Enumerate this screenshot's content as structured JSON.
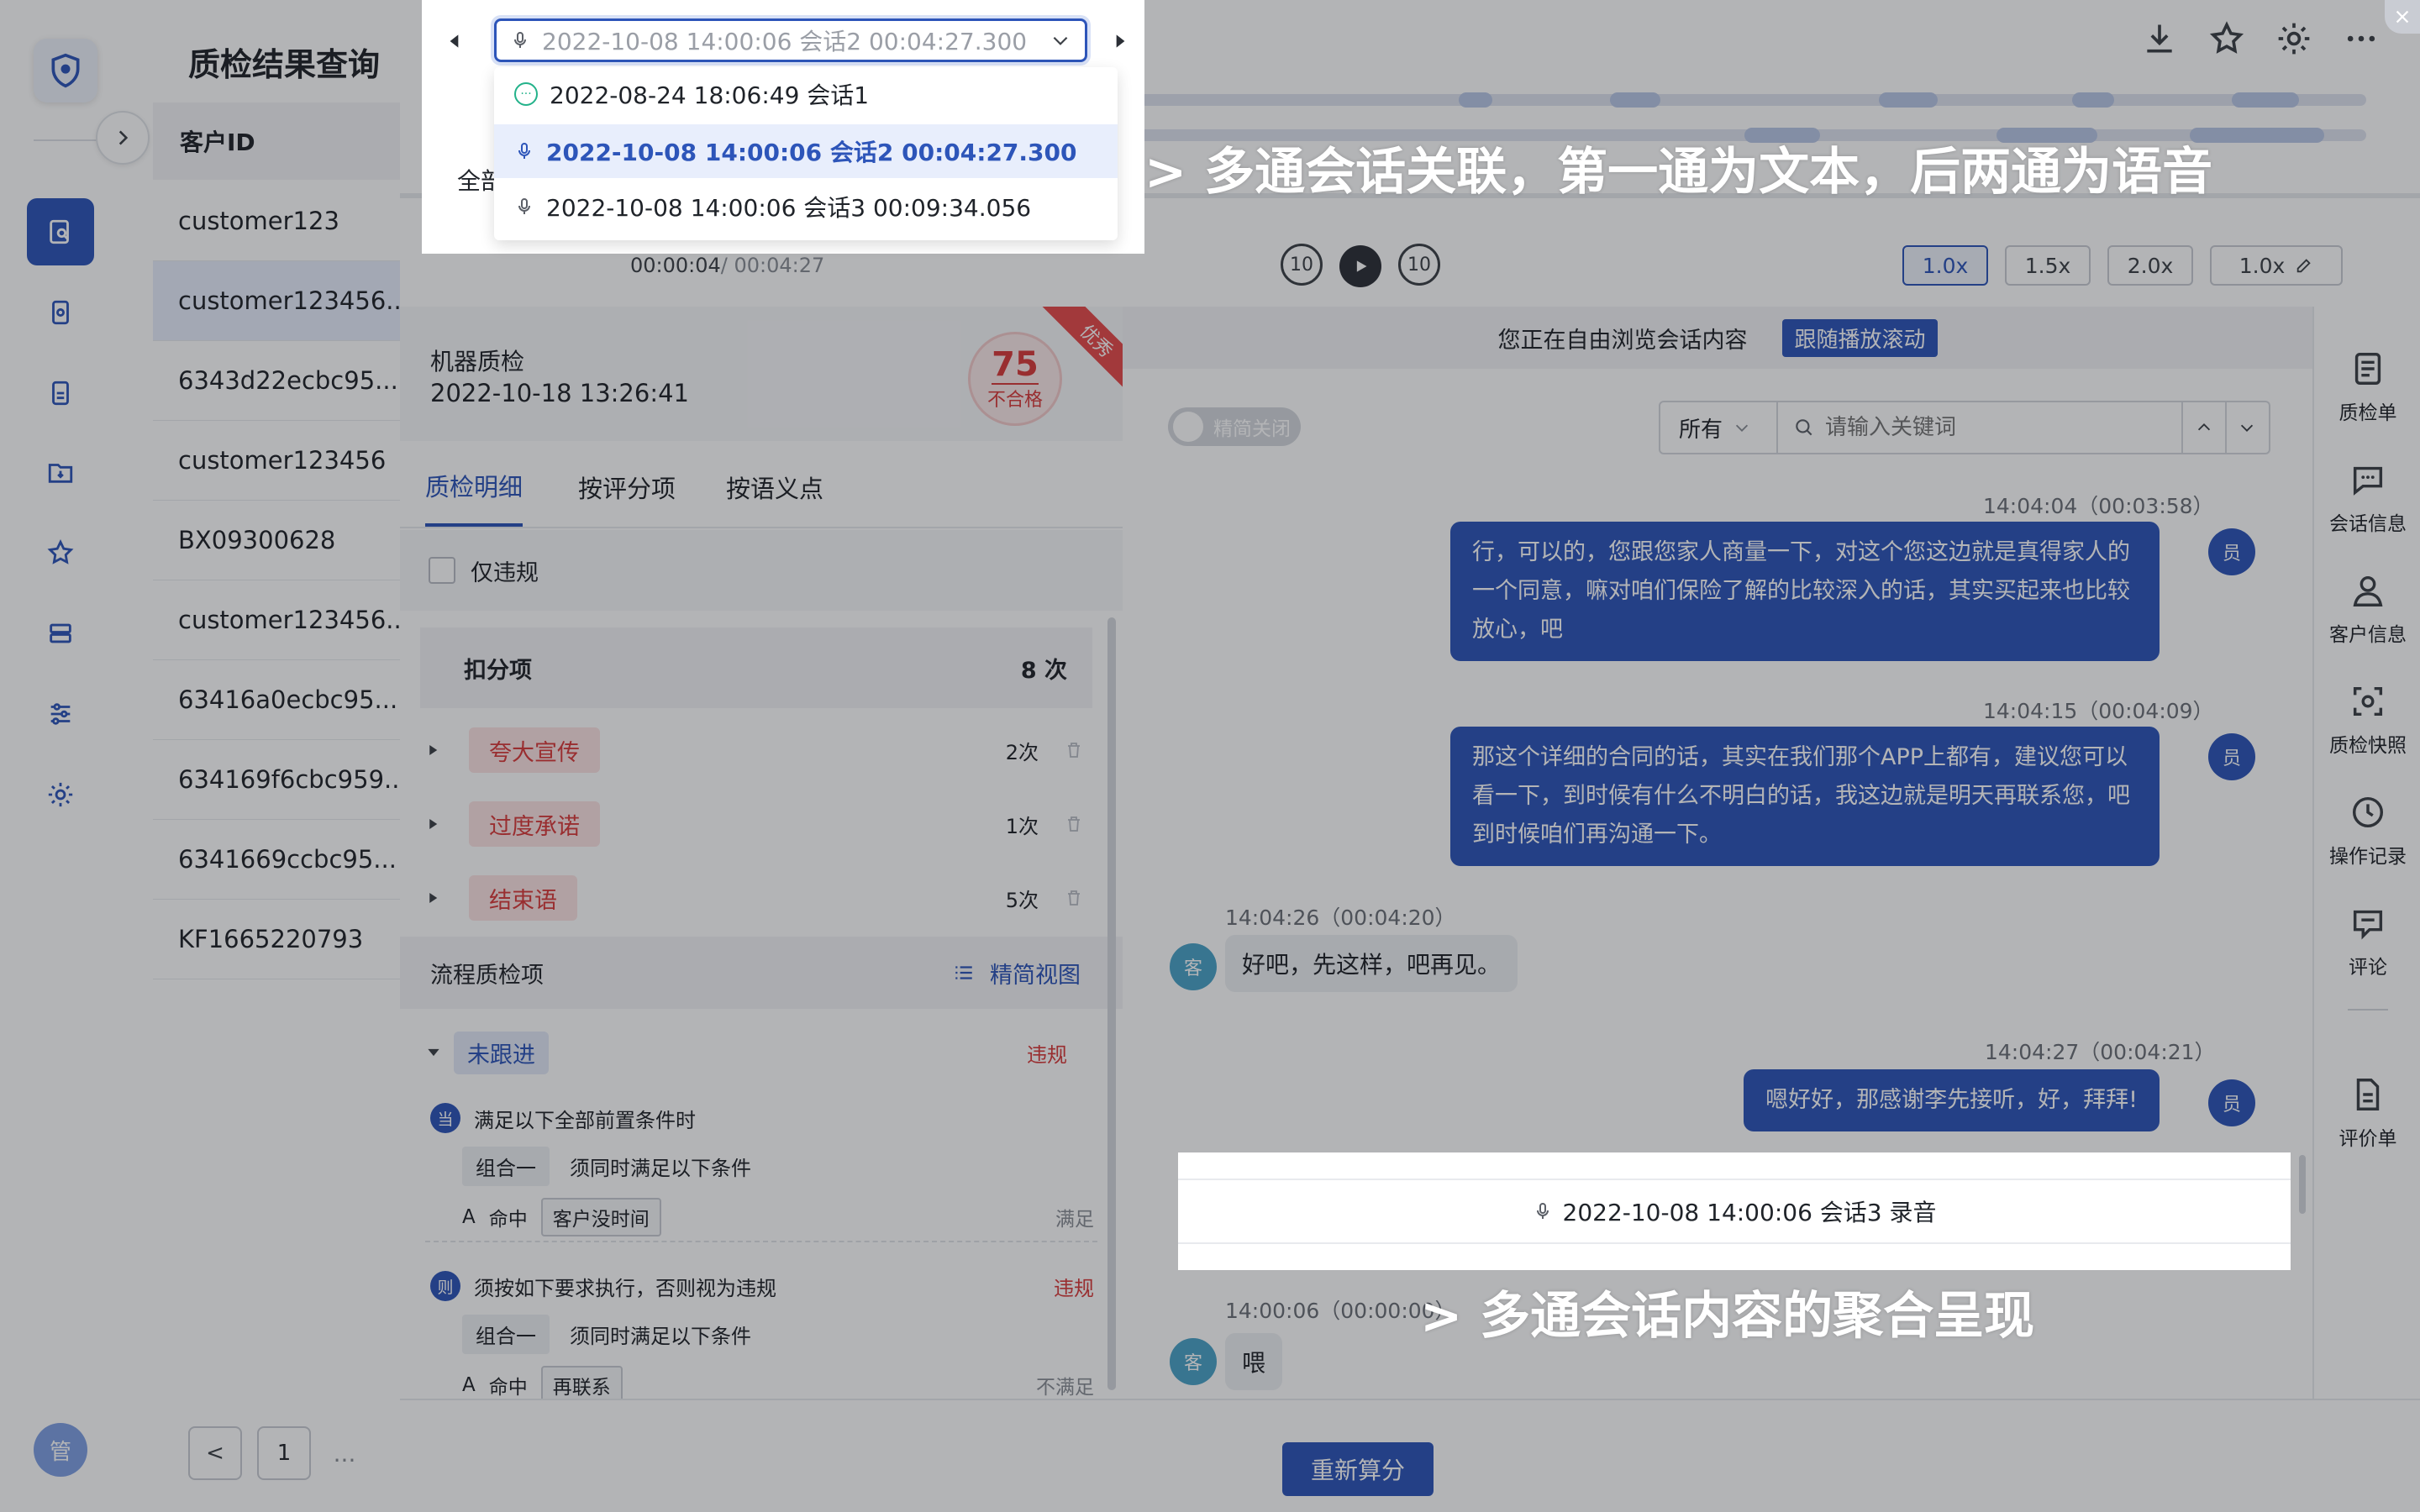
{
  "app": {
    "page_title": "质检结果查询",
    "user_avatar": "管",
    "accent": "#2d55b9"
  },
  "list": {
    "header": "客户ID",
    "rows": [
      "customer123",
      "customer123456...",
      "6343d22ecbc95...",
      "customer123456",
      "BX09300628",
      "customer123456...",
      "63416a0ecbc95...",
      "634169f6cbc959...",
      "6341669ccbc95...",
      "KF1665220793"
    ],
    "selected_index": 1,
    "pagination": {
      "prev": "<",
      "page": "1",
      "more": "..."
    }
  },
  "session_select": {
    "current": "2022-10-08 14:00:06 会话2 00:04:27.300",
    "options": [
      {
        "label": "2022-08-24 18:06:49 会话1",
        "type": "text"
      },
      {
        "label": "2022-10-08 14:00:06 会话2 00:04:27.300",
        "type": "voice",
        "selected": true
      },
      {
        "label": "2022-10-08 14:00:06 会话3 00:09:34.056",
        "type": "voice"
      }
    ],
    "partial_label": "全部"
  },
  "player": {
    "time_current": "00:00:04",
    "time_total": "/ 00:04:27",
    "rewind_label": "10",
    "forward_label": "10",
    "speeds": [
      "1.0x",
      "1.5x",
      "2.0x",
      "1.0x"
    ],
    "active_speed_index": 0
  },
  "machine_check": {
    "title": "机器质检",
    "datetime": "2022-10-18 13:26:41",
    "score": "75",
    "result": "不合格",
    "ribbon": "优秀"
  },
  "detail": {
    "tabs": [
      "质检明细",
      "按评分项",
      "按语义点"
    ],
    "active_tab": 0,
    "only_violation": "仅违规",
    "deduction_title": "扣分项",
    "deduction_count": "8 次",
    "deductions": [
      {
        "label": "夸大宣传",
        "count": "2次"
      },
      {
        "label": "过度承诺",
        "count": "1次"
      },
      {
        "label": "结束语",
        "count": "5次"
      }
    ],
    "flow_title": "流程质检项",
    "flow_view": "精简视图",
    "flow_item": "未跟进",
    "flow_item_status": "违规",
    "cond_when_badge": "当",
    "cond_when": "满足以下全部前置条件时",
    "group_label": "组合一",
    "group_desc": "须同时满足以下条件",
    "hit_a": "A",
    "hit_label": "命中",
    "hit1_tag": "客户没时间",
    "hit1_status": "满足",
    "cond_then_badge": "则",
    "cond_then": "须按如下要求执行，否则视为违规",
    "cond_then_status": "违规",
    "hit2_tag": "再联系",
    "hit2_status": "不满足"
  },
  "chat": {
    "browse_tip": "您正在自由浏览会话内容",
    "follow_button": "跟随播放滚动",
    "toggle_label": "精简关闭",
    "filter_value": "所有",
    "search_placeholder": "请输入关键词",
    "messages": [
      {
        "role": "emp",
        "avatar": "员",
        "time": "14:04:04（00:03:58）",
        "text": "行，可以的，您跟您家人商量一下，对这个您这边就是真得家人的一个同意，嘛对咱们保险了解的比较深入的话，其实买起来也比较放心，吧"
      },
      {
        "role": "emp",
        "avatar": "员",
        "time": "14:04:15（00:04:09）",
        "text": "那这个详细的合同的话，其实在我们那个APP上都有，建议您可以看一下，到时候有什么不明白的话，我这边就是明天再联系您，吧到时候咱们再沟通一下。"
      },
      {
        "role": "cus",
        "avatar": "客",
        "time": "14:04:26（00:04:20）",
        "text": "好吧，先这样，吧再见。"
      },
      {
        "role": "emp",
        "avatar": "员",
        "time": "14:04:27（00:04:21）",
        "text": "嗯好好，那感谢李先接听，好，拜拜!"
      }
    ],
    "session3_header": "2022-10-08 14:00:06 会话3 录音",
    "session3_msg_time": "14:00:06（00:00:00）",
    "session3_msg_avatar": "客",
    "session3_msg_text": "喂"
  },
  "right_tools": [
    "质检单",
    "会话信息",
    "客户信息",
    "质检快照",
    "操作记录",
    "评论",
    "评价单"
  ],
  "bottom": {
    "recalc": "重新算分"
  },
  "annotations": {
    "top": "> 多通会话关联，第一通为文本，后两通为语音",
    "bottom": "> 多通会话内容的聚合呈现"
  }
}
